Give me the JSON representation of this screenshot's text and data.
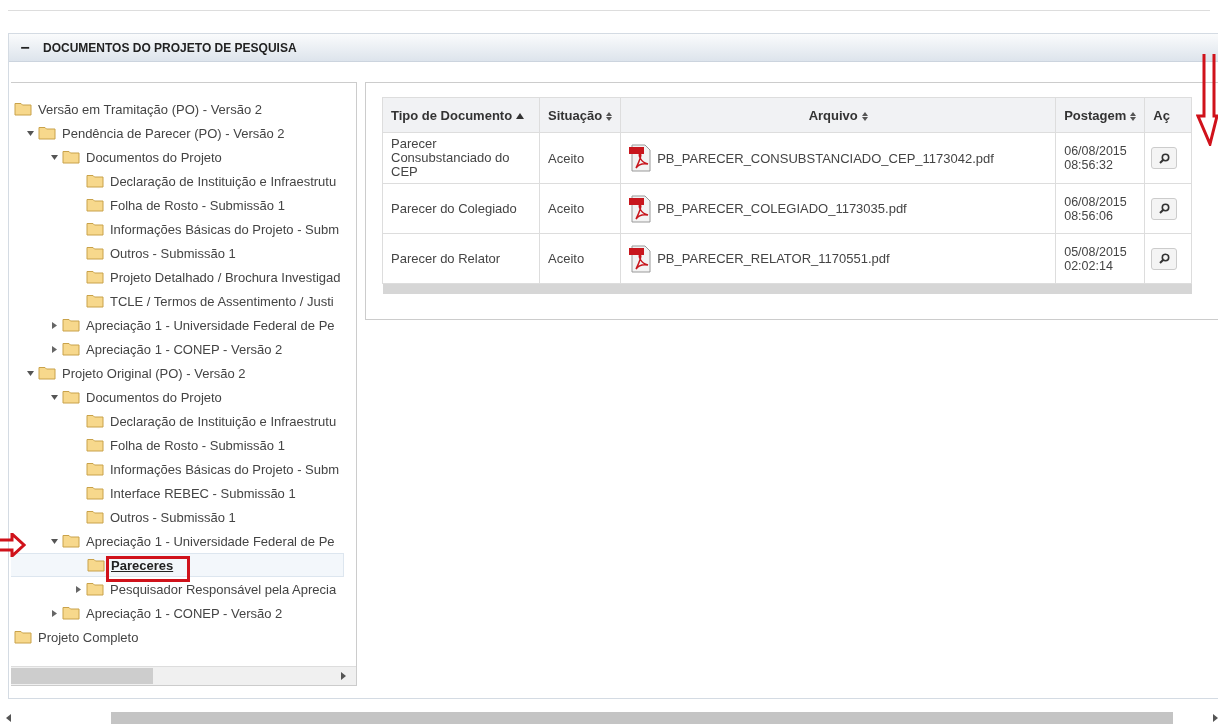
{
  "section": {
    "title": "DOCUMENTOS DO PROJETO DE PESQUISA",
    "toggle": "−"
  },
  "tree": [
    {
      "label": "Versão em Tramitação (PO) - Versão 2",
      "selected": false,
      "children": [
        {
          "label": "Pendência de Parecer (PO) - Versão 2",
          "selected": false,
          "expanded": true,
          "children": [
            {
              "label": "Documentos do Projeto",
              "selected": false,
              "expanded": true,
              "children": [
                {
                  "label": "Declaração de Instituição e Infraestrutu",
                  "selected": false
                },
                {
                  "label": "Folha de Rosto - Submissão 1",
                  "selected": false
                },
                {
                  "label": "Informações Básicas do Projeto - Subm",
                  "selected": false
                },
                {
                  "label": "Outros - Submissão 1",
                  "selected": false
                },
                {
                  "label": "Projeto Detalhado / Brochura Investigad",
                  "selected": false
                },
                {
                  "label": "TCLE / Termos de Assentimento / Justi",
                  "selected": false
                }
              ]
            },
            {
              "label": "Apreciação 1 - Universidade Federal de Pe",
              "selected": false,
              "expanded": false
            },
            {
              "label": "Apreciação 1 - CONEP - Versão 2",
              "selected": false,
              "expanded": false
            }
          ]
        },
        {
          "label": "Projeto Original (PO) - Versão 2",
          "selected": false,
          "expanded": true,
          "children": [
            {
              "label": "Documentos do Projeto",
              "selected": false,
              "expanded": true,
              "children": [
                {
                  "label": "Declaração de Instituição e Infraestrutu",
                  "selected": false
                },
                {
                  "label": "Folha de Rosto - Submissão 1",
                  "selected": false
                },
                {
                  "label": "Informações Básicas do Projeto - Subm",
                  "selected": false
                },
                {
                  "label": "Interface REBEC - Submissão 1",
                  "selected": false
                },
                {
                  "label": "Outros - Submissão 1",
                  "selected": false
                }
              ]
            },
            {
              "label": "Apreciação 1 - Universidade Federal de Pe",
              "selected": false,
              "expanded": true,
              "children": [
                {
                  "label": "Pareceres",
                  "selected": true
                },
                {
                  "label": "Pesquisador Responsável pela Aprecia",
                  "selected": false,
                  "expanded": false
                }
              ]
            },
            {
              "label": "Apreciação 1 - CONEP - Versão 2",
              "selected": false,
              "expanded": false
            }
          ]
        }
      ]
    },
    {
      "label": "Projeto Completo",
      "selected": false
    }
  ],
  "table": {
    "columns": [
      {
        "label": "Tipo de Documento",
        "sorted": true
      },
      {
        "label": "Situação",
        "sorted": false
      },
      {
        "label": "Arquivo",
        "sorted": false
      },
      {
        "label": "Postagem",
        "sorted": false
      },
      {
        "label": "Aç"
      }
    ],
    "rows": [
      {
        "type": "Parecer Consubstanciado do CEP",
        "status": "Aceito",
        "file": "PB_PARECER_CONSUBSTANCIADO_CEP_1173042.pdf",
        "date": "06/08/2015",
        "time": "08:56:32"
      },
      {
        "type": "Parecer do Colegiado",
        "status": "Aceito",
        "file": "PB_PARECER_COLEGIADO_1173035.pdf",
        "date": "06/08/2015",
        "time": "08:56:06"
      },
      {
        "type": "Parecer do Relator",
        "status": "Aceito",
        "file": "PB_PARECER_RELATOR_1170551.pdf",
        "date": "05/08/2015",
        "time": "02:02:14"
      }
    ]
  }
}
